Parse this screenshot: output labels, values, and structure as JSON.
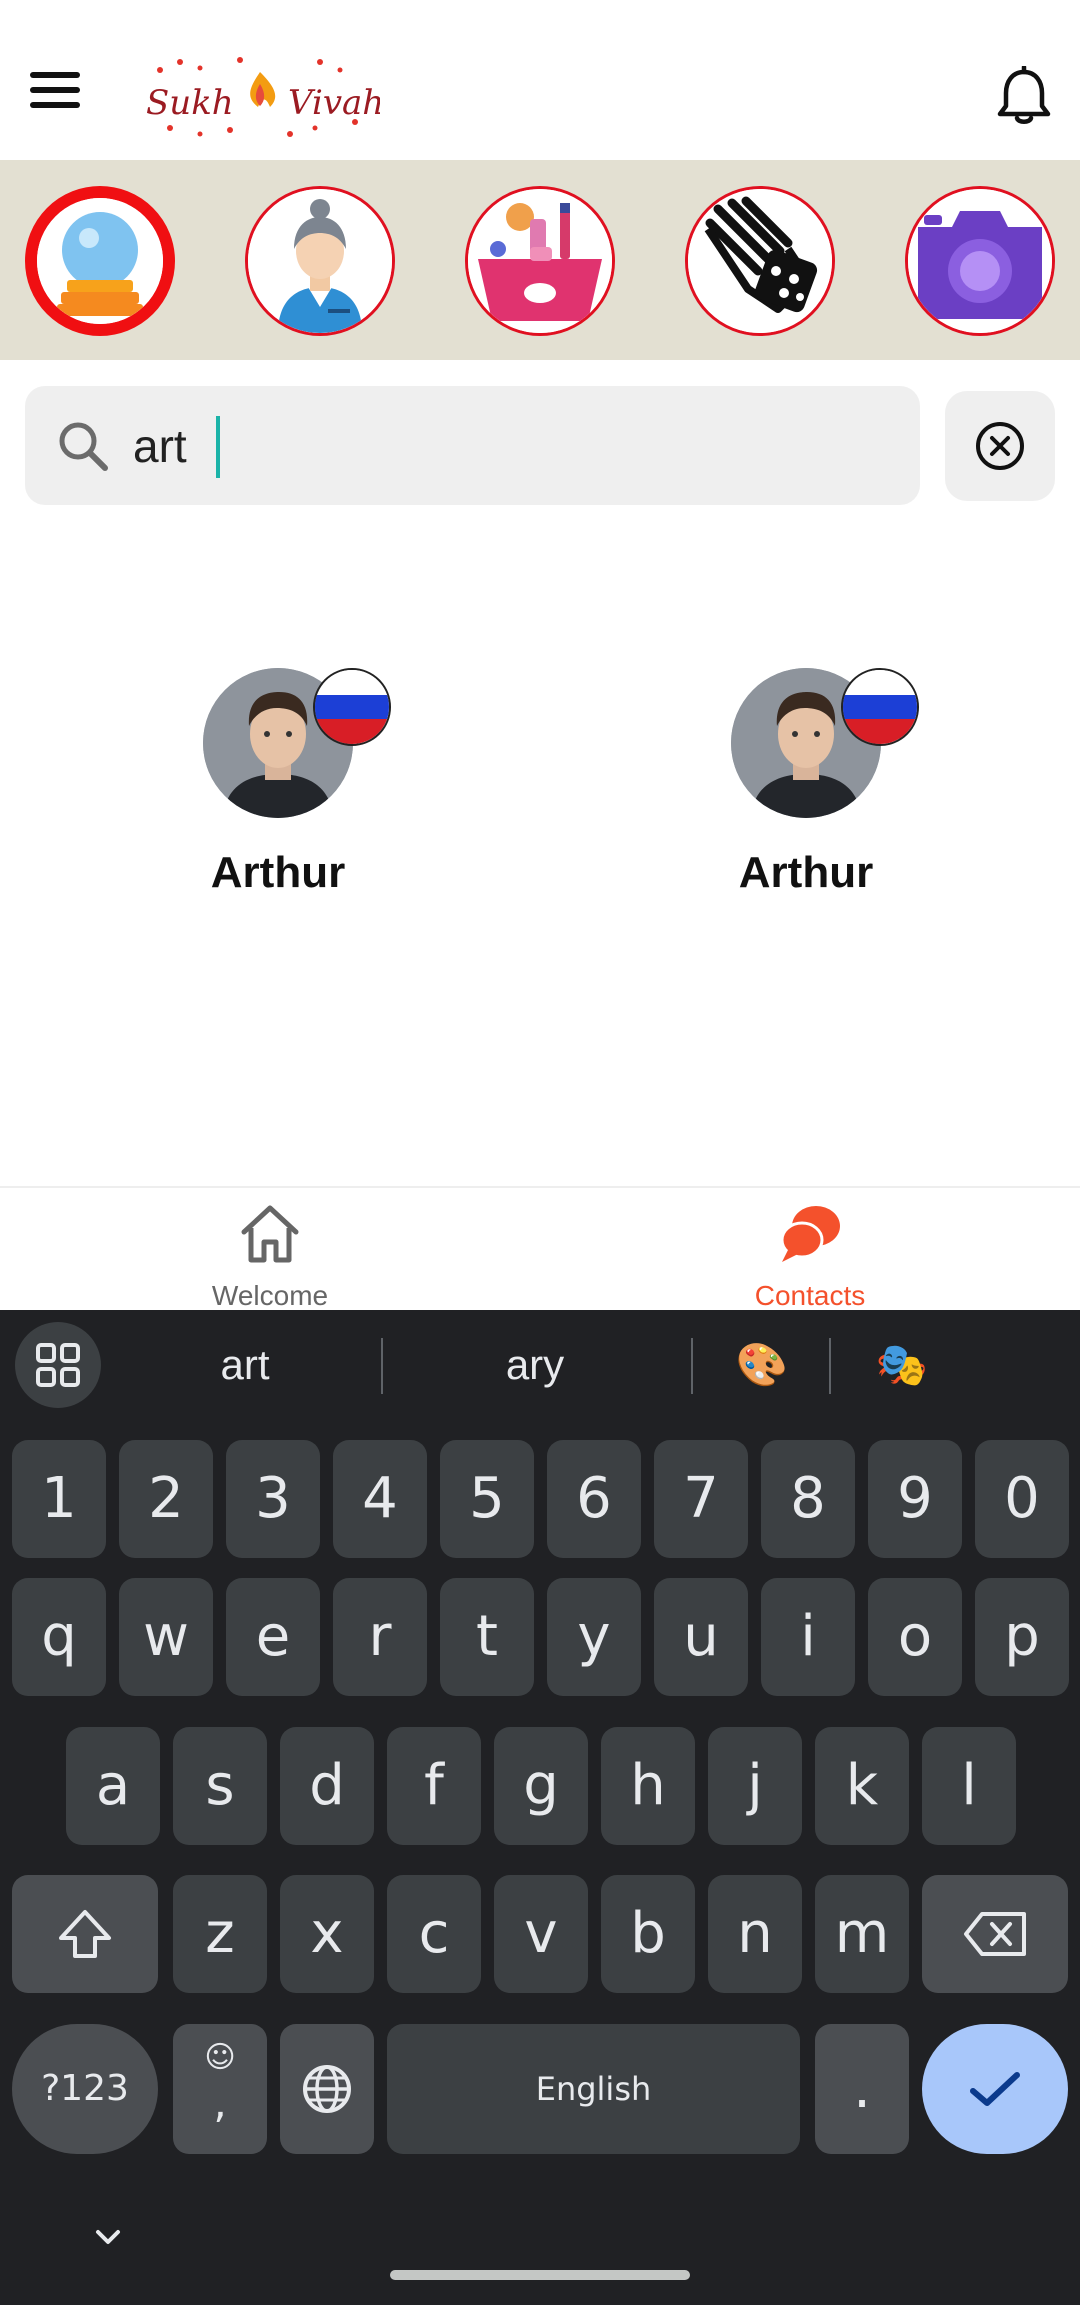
{
  "header": {
    "logo_text": "Sukh Vivah"
  },
  "categories": [
    {
      "icon": "crystal-ball-icon",
      "active": true
    },
    {
      "icon": "woman-profile-icon",
      "active": false
    },
    {
      "icon": "cosmetics-icon",
      "active": false
    },
    {
      "icon": "dice-hand-icon",
      "active": false
    },
    {
      "icon": "camera-icon",
      "active": false
    }
  ],
  "search": {
    "value": "art",
    "placeholder": ""
  },
  "results": [
    {
      "name": "Arthur",
      "flag": "russia-flag-icon"
    },
    {
      "name": "Arthur",
      "flag": "russia-flag-icon"
    }
  ],
  "bottom_nav": {
    "welcome_label": "Welcome",
    "contacts_label": "Contacts",
    "active_color": "#f4512c",
    "inactive_color": "#666666"
  },
  "keyboard": {
    "suggestions": [
      "art",
      "ary",
      "🎨",
      "🎭"
    ],
    "row_numbers": [
      "1",
      "2",
      "3",
      "4",
      "5",
      "6",
      "7",
      "8",
      "9",
      "0"
    ],
    "row_top": [
      "q",
      "w",
      "e",
      "r",
      "t",
      "y",
      "u",
      "i",
      "o",
      "p"
    ],
    "row_mid": [
      "a",
      "s",
      "d",
      "f",
      "g",
      "h",
      "j",
      "k",
      "l"
    ],
    "row_bottom": [
      "z",
      "x",
      "c",
      "v",
      "b",
      "n",
      "m"
    ],
    "symbols_label": "?123",
    "emoji_comma": ",",
    "space_label": "English",
    "period_label": "."
  }
}
